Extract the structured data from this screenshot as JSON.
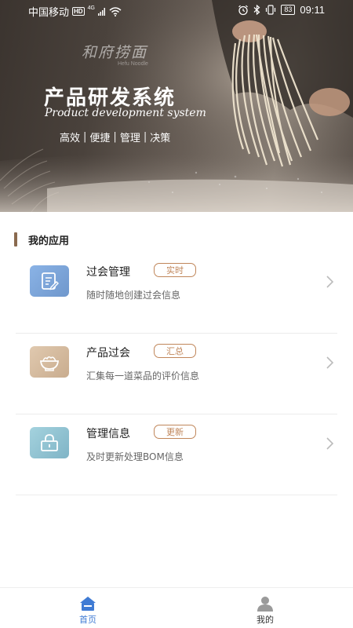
{
  "status_bar": {
    "carrier": "中国移动",
    "hd": "HD",
    "network": "4G",
    "battery": "83",
    "time": "09:11"
  },
  "hero": {
    "logo_text": "和府捞面",
    "logo_sub": "Hefu Noodle",
    "title": "产品研发系统",
    "subtitle": "Product development system",
    "tags": [
      "高效",
      "便捷",
      "管理",
      "决策"
    ]
  },
  "section": {
    "title": "我的应用",
    "accent_color": "#8a6a4f"
  },
  "apps": [
    {
      "name": "过会管理",
      "badge": "实时",
      "description": "随时随地创建过会信息",
      "icon": "document-edit-icon",
      "icon_color": "#7aa3d9"
    },
    {
      "name": "产品过会",
      "badge": "汇总",
      "description": "汇集每一道菜品的评价信息",
      "icon": "noodle-bowl-icon",
      "icon_color": "#d6bda1"
    },
    {
      "name": "管理信息",
      "badge": "更新",
      "description": "及时更新处理BOM信息",
      "icon": "lock-icon",
      "icon_color": "#93c6d4"
    }
  ],
  "tabbar": {
    "home_label": "首页",
    "mine_label": "我的",
    "active_color": "#3f7bd4"
  },
  "colors": {
    "badge": "#c0865a"
  }
}
